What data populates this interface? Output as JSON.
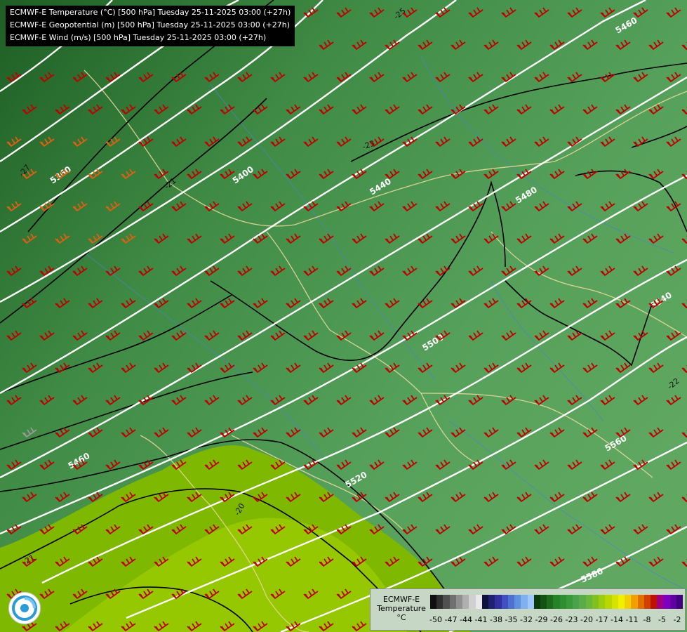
{
  "titles": [
    "ECMWF-E Temperature (°C) [500 hPa] Tuesday 25-11-2025 03:00 (+27h)",
    "ECMWF-E Geopotential (m) [500 hPa] Tuesday 25-11-2025 03:00 (+27h)",
    "ECMWF-E Wind (m/s) [500 hPa] Tuesday 25-11-2025 03:00 (+27h)"
  ],
  "geopotential_labels": [
    "5460",
    "5400",
    "5440",
    "5480",
    "5540",
    "5560",
    "5580",
    "5500",
    "5520",
    "5460",
    "5360"
  ],
  "temperature_labels": [
    "-23",
    "-21",
    "-22",
    "-20",
    "-21",
    "-27",
    "-25"
  ],
  "legend": {
    "title_line1": "ECMWF-E",
    "title_line2": "Temperature",
    "unit": "°C",
    "ticks": [
      "-50",
      "-47",
      "-44",
      "-41",
      "-38",
      "-35",
      "-32",
      "-29",
      "-26",
      "-23",
      "-20",
      "-17",
      "-14",
      "-11",
      "-8",
      "-5",
      "-2"
    ],
    "colors": [
      "#101010",
      "#303030",
      "#505050",
      "#707070",
      "#909090",
      "#b0b0b0",
      "#d0d0d0",
      "#e8e8e8",
      "#101040",
      "#202070",
      "#3030a0",
      "#4050c0",
      "#5070d0",
      "#6090e0",
      "#80b0f0",
      "#a0c8ff",
      "#0b3a0b",
      "#145214",
      "#1d6a1d",
      "#268226",
      "#2f8f2f",
      "#3a9a3a",
      "#4aa34a",
      "#5aac4a",
      "#6ab83a",
      "#80c020",
      "#9ccc10",
      "#b8d800",
      "#d4e400",
      "#f0f000",
      "#f0d000",
      "#f0a000",
      "#e07000",
      "#d04000",
      "#c01000",
      "#a00080",
      "#8000c0",
      "#6000a0",
      "#400080"
    ],
    "colors_legend_count": 39
  }
}
